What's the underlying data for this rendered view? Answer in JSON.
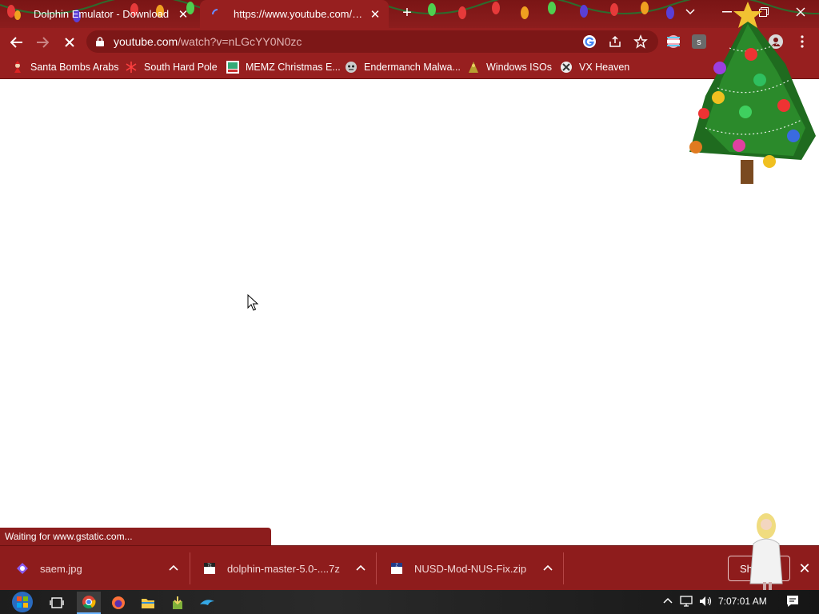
{
  "tabs": [
    {
      "title": "Dolphin Emulator - Download",
      "icon": "christmas-lights-favicon",
      "active": false
    },
    {
      "title": "https://www.youtube.com/watch",
      "icon": "loading-spinner-icon",
      "active": true
    }
  ],
  "address_bar": {
    "domain": "youtube.com",
    "path": "/watch?v=nLGcYY0N0zc"
  },
  "bookmarks": [
    {
      "label": "Santa Bombs Arabs",
      "icon": "santa-icon"
    },
    {
      "label": "South Hard Pole",
      "icon": "snowflake-icon"
    },
    {
      "label": "MEMZ Christmas E...",
      "icon": "memz-icon"
    },
    {
      "label": "Endermanch Malwa...",
      "icon": "endermanch-icon"
    },
    {
      "label": "Windows ISOs",
      "icon": "windows-isos-icon"
    },
    {
      "label": "VX Heaven",
      "icon": "vx-heaven-icon"
    }
  ],
  "status_text": "Waiting for www.gstatic.com...",
  "downloads": [
    {
      "name": "saem.jpg",
      "icon": "image-file-icon"
    },
    {
      "name": "dolphin-master-5.0-....7z",
      "icon": "7z-archive-icon"
    },
    {
      "name": "NUSD-Mod-NUS-Fix.zip",
      "icon": "zip-archive-icon"
    }
  ],
  "show_all_label": "Sh",
  "clock": "7:07:01 AM",
  "colors": {
    "theme_red": "#971f1f",
    "tabstrip_red": "#8c1d1d",
    "download_bar": "#8e1c1c"
  }
}
